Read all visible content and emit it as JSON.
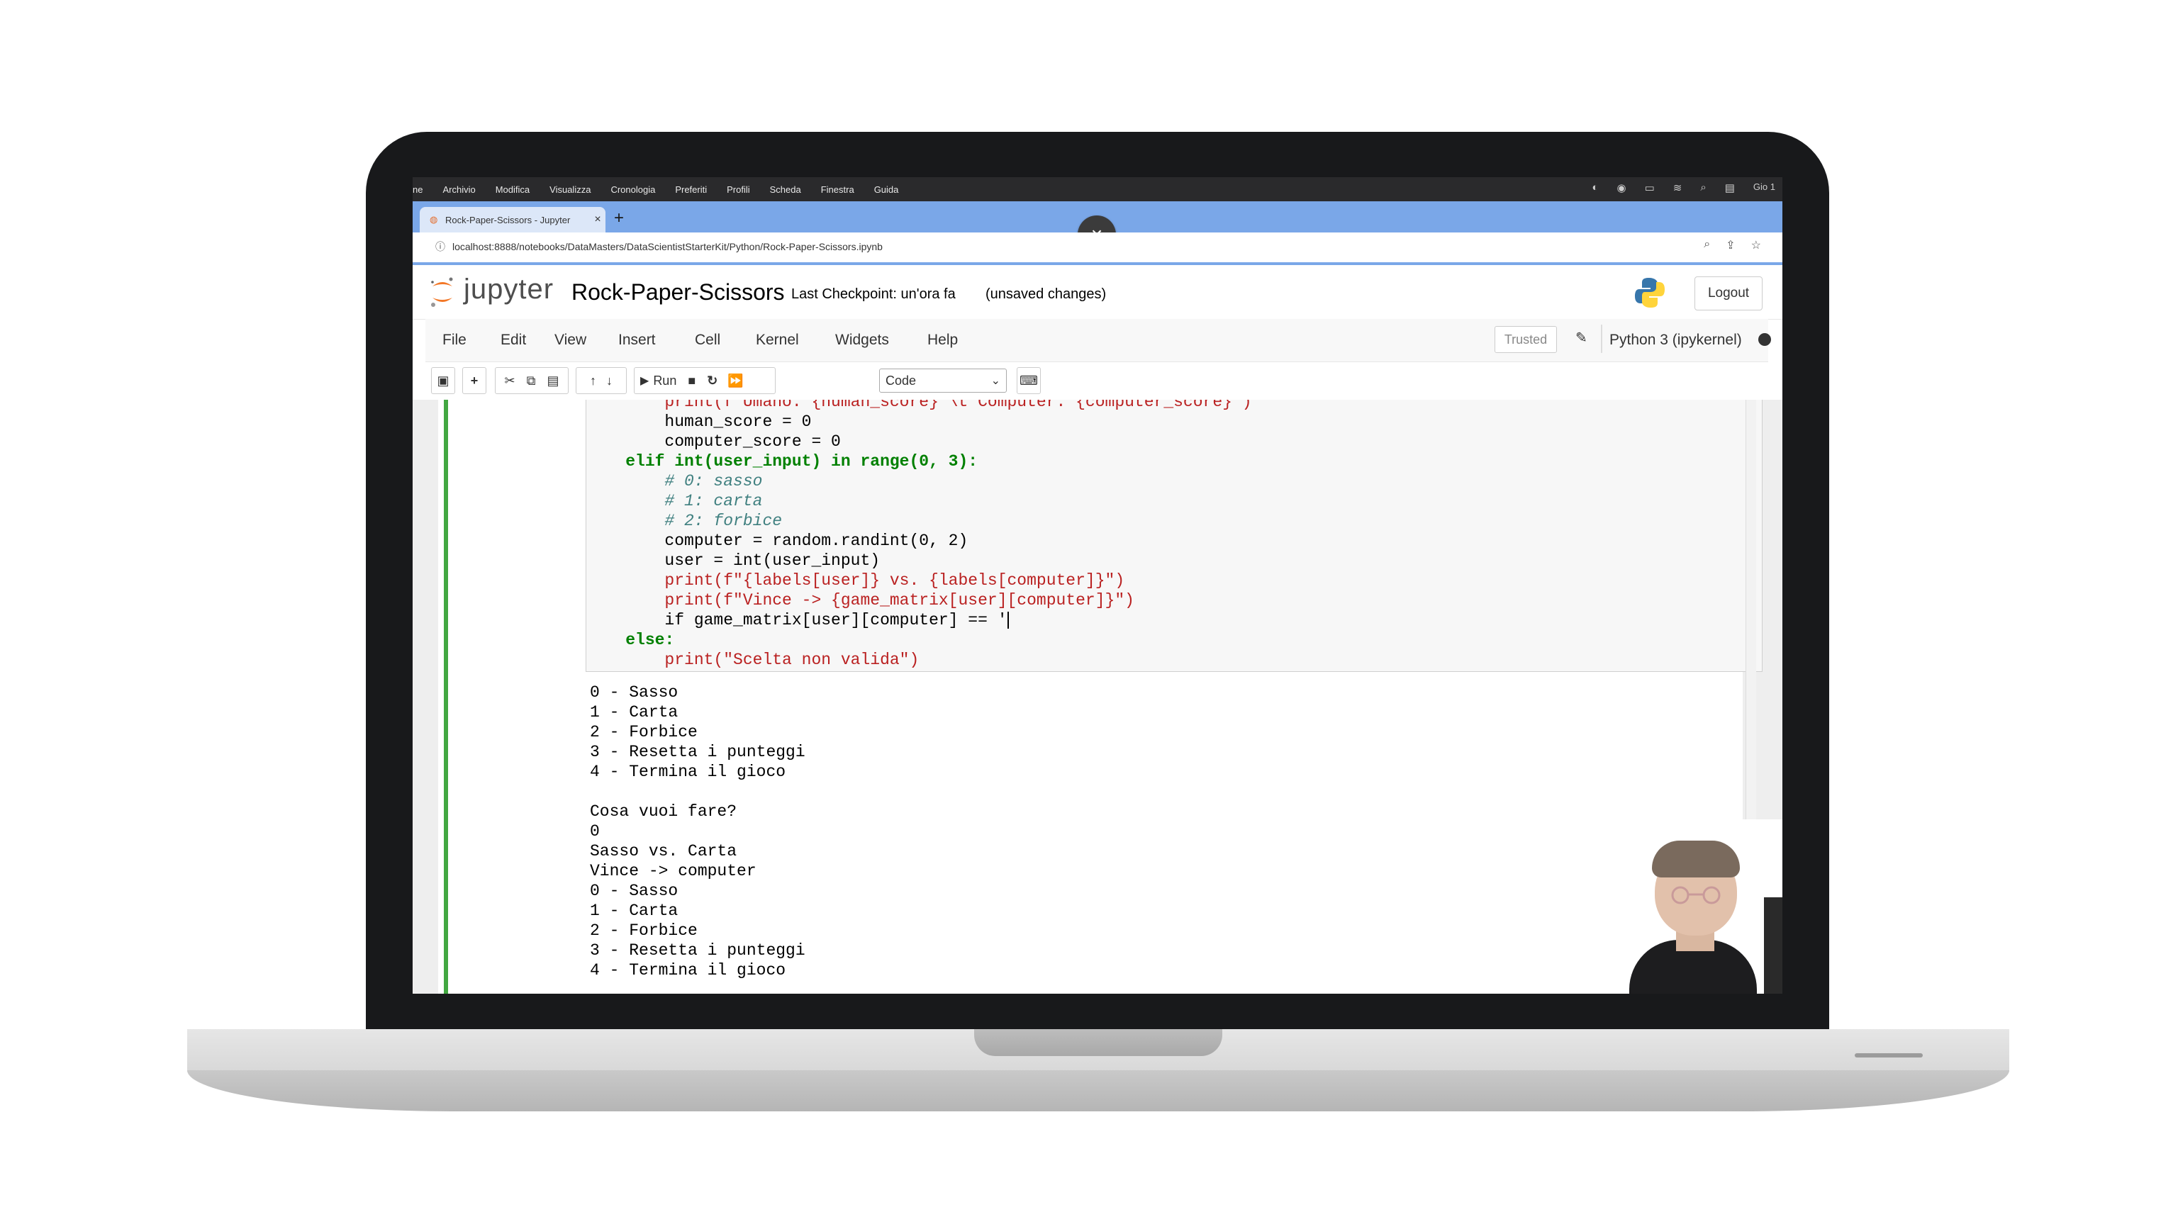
{
  "mac_menu": [
    "ne",
    "Archivio",
    "Modifica",
    "Visualizza",
    "Cronologia",
    "Preferiti",
    "Profili",
    "Scheda",
    "Finestra",
    "Guida"
  ],
  "mac_clock": "Gio 1",
  "browser": {
    "tab_title": "Rock-Paper-Scissors - Jupyter",
    "tab_close": "×",
    "new_tab": "+",
    "overlay_close": "×",
    "url": "localhost:8888/notebooks/DataMasters/DataScientistStarterKit/Python/Rock-Paper-Scissors.ipynb"
  },
  "jupyter": {
    "logo": "jupyter",
    "notebook_title": "Rock-Paper-Scissors",
    "checkpoint": "Last Checkpoint: un'ora fa",
    "unsaved": "(unsaved changes)",
    "logout": "Logout",
    "menu": [
      "File",
      "Edit",
      "View",
      "Insert",
      "Cell",
      "Kernel",
      "Widgets",
      "Help"
    ],
    "trusted": "Trusted",
    "kernel": "Python 3 (ipykernel)",
    "run_label": "Run",
    "cell_type": "Code"
  },
  "code_lines": [
    "        print(f\"Umano: {human_score} \\t Computer: {computer_score}\")",
    "        human_score = 0",
    "        computer_score = 0",
    "    elif int(user_input) in range(0, 3):",
    "        # 0: sasso",
    "        # 1: carta",
    "        # 2: forbice",
    "        computer = random.randint(0, 2)",
    "        user = int(user_input)",
    "        print(f\"{labels[user]} vs. {labels[computer]}\")",
    "        print(f\"Vince -> {game_matrix[user][computer]}\")",
    "        if game_matrix[user][computer] == '",
    "    else:",
    "        print(\"Scelta non valida\")"
  ],
  "output_lines": [
    "0 - Sasso",
    "1 - Carta",
    "2 - Forbice",
    "3 - Resetta i punteggi",
    "4 - Termina il gioco",
    "",
    "Cosa vuoi fare?",
    "0",
    "Sasso vs. Carta",
    "Vince -> computer",
    "0 - Sasso",
    "1 - Carta",
    "2 - Forbice",
    "3 - Resetta i punteggi",
    "4 - Termina il gioco"
  ]
}
